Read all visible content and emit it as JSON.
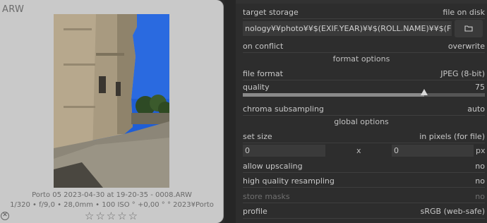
{
  "thumbnail": {
    "extension": "ARW",
    "filename_line": "Porto 05 2023-04-30 at 19-20-35 - 0008.ARW",
    "exif_line": "1/320 • f/9,0 • 28,0mm • 100 ISO  ° +0,00 °  ° 2023¥Porto",
    "stars": "☆☆☆☆☆",
    "reject_glyph": "✕"
  },
  "export": {
    "target_storage": {
      "label": "target storage",
      "value": "file on disk"
    },
    "path_value": "nology¥¥photo¥¥$(EXIF.YEAR)¥¥$(ROLL.NAME)¥¥$(FILE_NAME)_dt",
    "on_conflict": {
      "label": "on conflict",
      "value": "overwrite"
    },
    "format_options_title": "format options",
    "file_format": {
      "label": "file format",
      "value": "JPEG (8-bit)"
    },
    "quality": {
      "label": "quality",
      "value": "75",
      "fraction": 0.75
    },
    "chroma": {
      "label": "chroma subsampling",
      "value": "auto"
    },
    "global_options_title": "global options",
    "set_size": {
      "label": "set size",
      "value": "in pixels (for file)"
    },
    "width_value": "0",
    "times_sign": "x",
    "height_value": "0",
    "unit": "px",
    "allow_upscaling": {
      "label": "allow upscaling",
      "value": "no"
    },
    "high_quality": {
      "label": "high quality resampling",
      "value": "no"
    },
    "store_masks": {
      "label": "store masks",
      "value": "no"
    },
    "profile": {
      "label": "profile",
      "value": "sRGB (web-safe)"
    }
  },
  "colors": {
    "panel_bg": "#2d2d2d",
    "card_bg": "#c9c9c9",
    "sky": "#1f5ed6"
  },
  "icons": {
    "folder": "folder-icon",
    "reject": "reject-icon",
    "stars": "star-icon"
  }
}
